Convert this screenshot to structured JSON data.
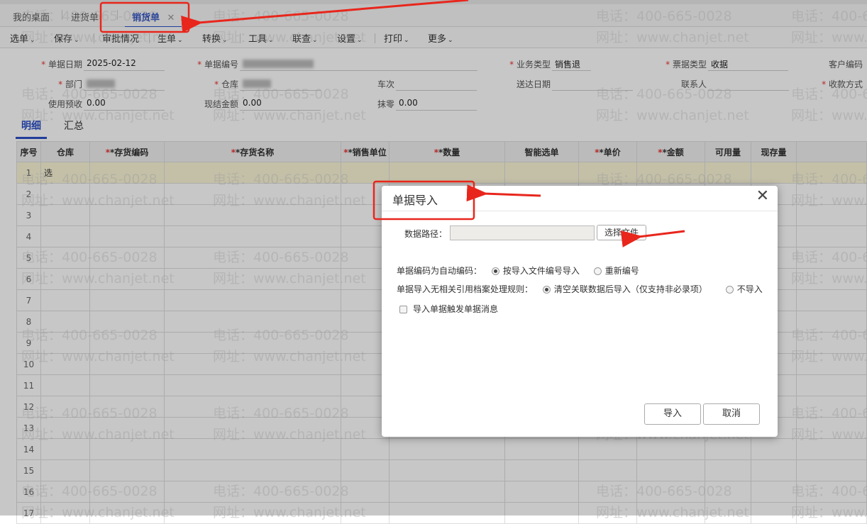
{
  "tabs": [
    {
      "label": "我的桌面"
    },
    {
      "label": "进货单"
    },
    {
      "label": "销货单",
      "active": true
    }
  ],
  "close_glyph": "✕",
  "toolbar": [
    "选单",
    "保存",
    "审批情况",
    "生单",
    "转换",
    "工具",
    "联查",
    "设置",
    "打印",
    "更多"
  ],
  "form": {
    "date_label": "单据日期",
    "date_value": "2025-02-12",
    "number_label": "单据编号",
    "biz_type_label": "业务类型",
    "biz_type_value": "销售退",
    "bill_type_label": "票据类型",
    "bill_type_value": "收据",
    "customer_code_label": "客户编码",
    "dept_label": "部门",
    "warehouse_label": "仓库",
    "vehicle_label": "车次",
    "delivery_date_label": "送达日期",
    "contact_label": "联系人",
    "payment_label": "收款方式",
    "prepay_label": "使用预收",
    "prepay_value": "0.00",
    "cash_label": "现结金额",
    "cash_value": "0.00",
    "rounding_label": "抹零",
    "rounding_value": "0.00"
  },
  "subtabs": [
    "明细",
    "汇总"
  ],
  "table": {
    "headers": [
      "序号",
      "仓库",
      "*存货编码",
      "*存货名称",
      "*销售单位",
      "*数量",
      "智能选单",
      "*单价",
      "*金额",
      "可用量",
      "现存量"
    ],
    "rows": [
      "1",
      "2",
      "3",
      "4",
      "5",
      "6",
      "7",
      "8",
      "9",
      "10",
      "11",
      "12",
      "13",
      "14",
      "15",
      "16",
      "17"
    ],
    "row1_warehouse": "选"
  },
  "watermark": {
    "phone": "电话：400-665-0028",
    "site": "网址：www.chanjet.net"
  },
  "dialog": {
    "title": "单据导入",
    "close": "✕",
    "path_label": "数据路径：",
    "path_value": "",
    "choose_file": "选择文件",
    "auto_code_label": "单据编码为自动编码：",
    "auto_opt1": "按导入文件编号导入",
    "auto_opt2": "重新编号",
    "rule_label": "单据导入无相关引用档案处理规则：",
    "rule_opt1": "清空关联数据后导入（仅支持非必录项）",
    "rule_opt2": "不导入",
    "trigger_label": "导入单据触发单据消息",
    "import": "导入",
    "cancel": "取消"
  },
  "colors": {
    "accent": "#2b4fc6",
    "annotation": "#e8261c"
  }
}
